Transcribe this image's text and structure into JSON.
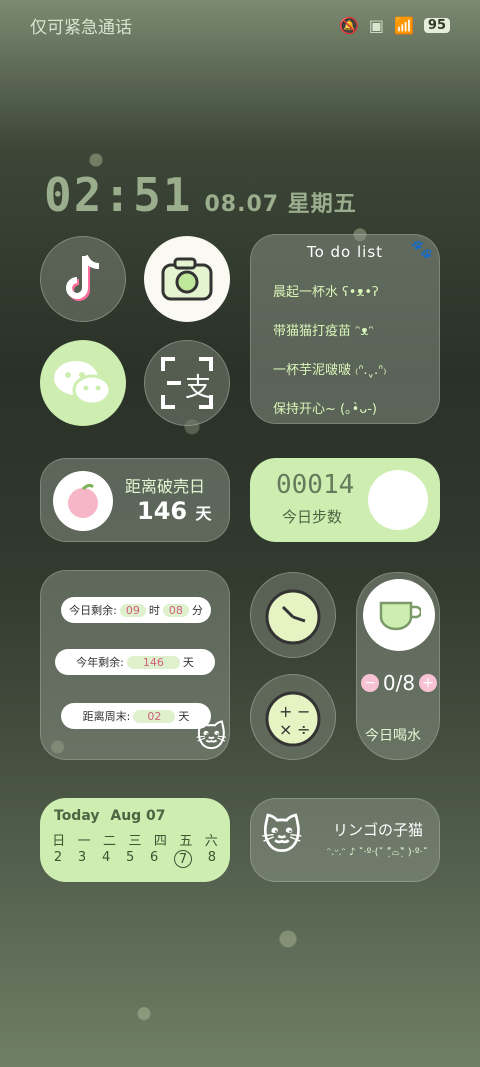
{
  "status": {
    "carrier": "仅可紧急通话",
    "battery": "95"
  },
  "clock": {
    "time": "02:51",
    "date": "08.07 星期五"
  },
  "apps": {
    "tiktok": "tiktok-app",
    "camera": "camera-app",
    "wechat": "wechat-app",
    "scan": "支"
  },
  "todo": {
    "title": "To do list",
    "items": [
      "晨起一杯水 ʕ•ᴥ•ʔ",
      "带猫猫打疫苗 ᵔᴥᵔ",
      "一杯芋泥啵啵 ₍ᐢ.ˬ.ᐢ₎",
      "保持开心~ (｡•̀ᴗ-)"
    ]
  },
  "countdown": {
    "label": "距离破壳日",
    "days": "146",
    "unit": "天"
  },
  "steps": {
    "count": "00014",
    "label": "今日步数"
  },
  "remain": {
    "today_label": "今日剩余:",
    "hours": "09",
    "hour_unit": "时",
    "minutes": "08",
    "minute_unit": "分",
    "year_label": "今年剩余:",
    "year_days": "146",
    "year_unit": "天",
    "weekend_label": "距离周末:",
    "weekend_days": "02",
    "weekend_unit": "天"
  },
  "water": {
    "count": "0/8",
    "label": "今日喝水",
    "minus": "−",
    "plus": "+"
  },
  "calendar": {
    "today": "Today",
    "month": "Aug 07",
    "weekdays": [
      "日",
      "一",
      "二",
      "三",
      "四",
      "五",
      "六"
    ],
    "days": [
      "2",
      "3",
      "4",
      "5",
      "6",
      "7",
      "8"
    ]
  },
  "profile": {
    "name": "リンゴの子猫",
    "sub": "ᵔ.ᵕ.ᵔ ♪ ˚‧º·(˚ ˃̣̣̥᷄⌓˂̣̣̥᷅ )‧º·˚"
  }
}
